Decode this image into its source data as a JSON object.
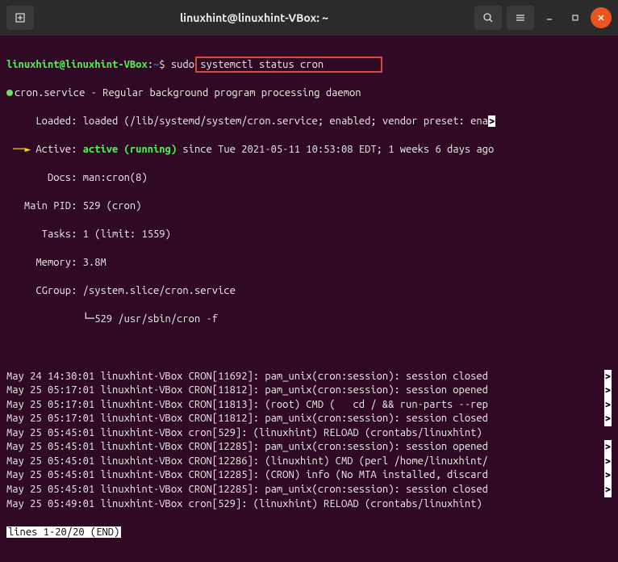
{
  "titlebar": {
    "title": "linuxhint@linuxhint-VBox: ~"
  },
  "prompt": {
    "userhost": "linuxhint@linuxhint-VBox",
    "sep": ":",
    "path": "~",
    "dollar": "$",
    "command": "sudo systemctl status cron"
  },
  "status": {
    "unit": "cron.service - Regular background program processing daemon",
    "loaded_label": "     Loaded: ",
    "loaded_value": "loaded (/lib/systemd/system/cron.service; enabled; vendor preset: ena",
    "active_label": "     Active: ",
    "active_value": "active (running)",
    "active_since": " since Tue 2021-05-11 10:53:08 EDT; 1 weeks 6 days ago",
    "docs": "       Docs: man:cron(8)",
    "mainpid": "   Main PID: 529 (cron)",
    "tasks": "      Tasks: 1 (limit: 1559)",
    "memory": "     Memory: 3.8M",
    "cgroup": "     CGroup: /system.slice/cron.service",
    "cgroup_sub": "             └─529 /usr/sbin/cron -f"
  },
  "logs": [
    {
      "text": "May 24 14:30:01 linuxhint-VBox CRON[11692]: pam_unix(cron:session): session closed",
      "cont": true
    },
    {
      "text": "May 25 05:17:01 linuxhint-VBox CRON[11812]: pam_unix(cron:session): session opened",
      "cont": true
    },
    {
      "text": "May 25 05:17:01 linuxhint-VBox CRON[11813]: (root) CMD (   cd / && run-parts --rep",
      "cont": true
    },
    {
      "text": "May 25 05:17:01 linuxhint-VBox CRON[11812]: pam_unix(cron:session): session closed",
      "cont": true
    },
    {
      "text": "May 25 05:45:01 linuxhint-VBox cron[529]: (linuxhint) RELOAD (crontabs/linuxhint)",
      "cont": false
    },
    {
      "text": "May 25 05:45:01 linuxhint-VBox CRON[12285]: pam_unix(cron:session): session opened",
      "cont": true
    },
    {
      "text": "May 25 05:45:01 linuxhint-VBox CRON[12286]: (linuxhint) CMD (perl /home/linuxhint/",
      "cont": true
    },
    {
      "text": "May 25 05:45:01 linuxhint-VBox CRON[12285]: (CRON) info (No MTA installed, discard",
      "cont": true
    },
    {
      "text": "May 25 05:45:01 linuxhint-VBox CRON[12285]: pam_unix(cron:session): session closed",
      "cont": true
    },
    {
      "text": "May 25 05:49:01 linuxhint-VBox cron[529]: (linuxhint) RELOAD (crontabs/linuxhint)",
      "cont": false
    }
  ],
  "pager": {
    "status": "lines 1-20/20 (END)"
  },
  "glyphs": {
    "cont": ">"
  }
}
